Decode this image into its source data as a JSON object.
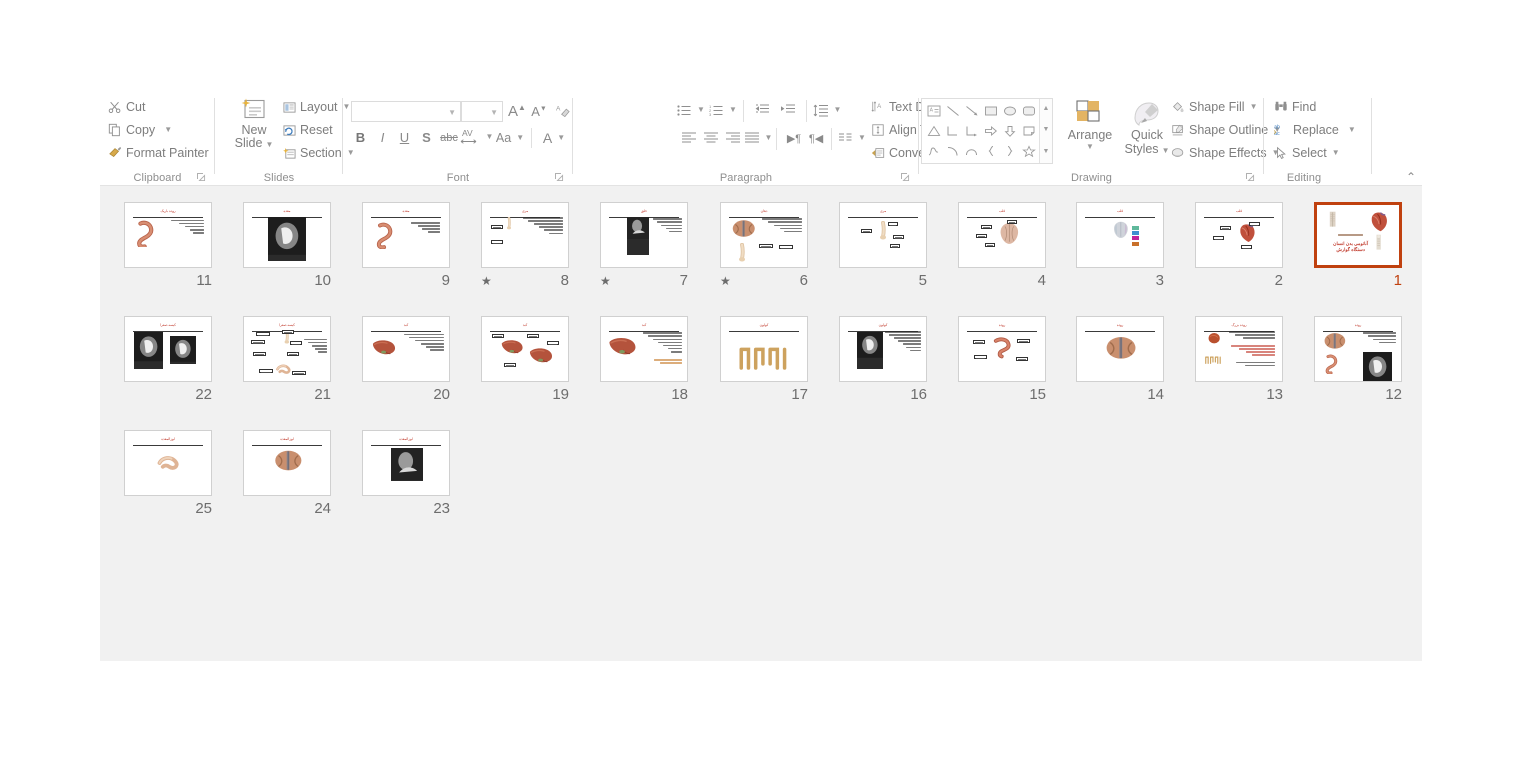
{
  "app": {
    "name": "PowerPoint Slide Sorter",
    "view": "slide-sorter"
  },
  "ribbon": {
    "groups": [
      {
        "id": "clipboard",
        "label": "Clipboard",
        "has_dialog_launcher": true,
        "items": [
          {
            "id": "cut",
            "label": "Cut",
            "icon": "scissors-icon",
            "caret": false
          },
          {
            "id": "copy",
            "label": "Copy",
            "icon": "copy-icon",
            "caret": true
          },
          {
            "id": "format-painter",
            "label": "Format Painter",
            "icon": "paintbrush-icon",
            "caret": false
          }
        ]
      },
      {
        "id": "slides",
        "label": "Slides",
        "has_dialog_launcher": false,
        "items": [
          {
            "id": "new-slide",
            "label": "New Slide",
            "icon": "new-slide-icon",
            "caret": true
          },
          {
            "id": "layout",
            "label": "Layout",
            "icon": "layout-icon",
            "caret": true
          },
          {
            "id": "reset",
            "label": "Reset",
            "icon": "reset-icon",
            "caret": false
          },
          {
            "id": "section",
            "label": "Section",
            "icon": "section-icon",
            "caret": true
          }
        ]
      },
      {
        "id": "font",
        "label": "Font",
        "has_dialog_launcher": true,
        "font_name": {
          "value": "",
          "placeholder": ""
        },
        "font_size": {
          "value": "",
          "placeholder": ""
        },
        "items": [
          {
            "id": "increase-font-size",
            "label": "A",
            "icon": "increase-font-size-icon"
          },
          {
            "id": "decrease-font-size",
            "label": "A",
            "icon": "decrease-font-size-icon"
          },
          {
            "id": "clear-formatting",
            "label": "",
            "icon": "clear-formatting-icon"
          },
          {
            "id": "bold",
            "label": "B",
            "icon": "bold-icon"
          },
          {
            "id": "italic",
            "label": "I",
            "icon": "italic-icon"
          },
          {
            "id": "underline",
            "label": "U",
            "icon": "underline-icon"
          },
          {
            "id": "text-shadow",
            "label": "S",
            "icon": "text-shadow-icon"
          },
          {
            "id": "strikethrough",
            "label": "abc",
            "icon": "strikethrough-icon"
          },
          {
            "id": "character-spacing",
            "label": "AV",
            "icon": "character-spacing-icon"
          },
          {
            "id": "change-case",
            "label": "Aa",
            "icon": "change-case-icon"
          },
          {
            "id": "font-color",
            "label": "A",
            "icon": "font-color-icon"
          }
        ]
      },
      {
        "id": "paragraph",
        "label": "Paragraph",
        "has_dialog_launcher": true,
        "items": [
          {
            "id": "bullets",
            "icon": "bullets-icon",
            "caret": true
          },
          {
            "id": "numbering",
            "icon": "numbering-icon",
            "caret": true
          },
          {
            "id": "decrease-indent",
            "icon": "decrease-indent-icon",
            "caret": false
          },
          {
            "id": "increase-indent",
            "icon": "increase-indent-icon",
            "caret": false
          },
          {
            "id": "line-spacing",
            "icon": "line-spacing-icon",
            "caret": true
          },
          {
            "id": "align-left",
            "icon": "align-left-icon",
            "caret": false
          },
          {
            "id": "align-center",
            "icon": "align-center-icon",
            "caret": false
          },
          {
            "id": "align-right",
            "icon": "align-right-icon",
            "caret": false
          },
          {
            "id": "justify",
            "icon": "justify-icon",
            "caret": true
          },
          {
            "id": "ltr-text-direction",
            "icon": "ltr-paragraph-icon",
            "caret": false
          },
          {
            "id": "rtl-text-direction",
            "icon": "rtl-paragraph-icon",
            "caret": false
          },
          {
            "id": "columns",
            "icon": "columns-icon",
            "caret": true
          }
        ],
        "menu_items": [
          {
            "id": "text-direction",
            "label": "Text Direction",
            "icon": "text-direction-icon",
            "caret": true
          },
          {
            "id": "align-text",
            "label": "Align Text",
            "icon": "align-text-icon",
            "caret": true
          },
          {
            "id": "convert-to-smartart",
            "label": "Convert to SmartArt",
            "icon": "smartart-icon",
            "caret": true
          }
        ]
      },
      {
        "id": "drawing",
        "label": "Drawing",
        "has_dialog_launcher": true,
        "shapes": [
          "text-box-icon",
          "line-icon",
          "arrow-icon",
          "rectangle-icon",
          "oval-icon",
          "rounded-rectangle-icon",
          "triangle-icon",
          "elbow-connector-icon",
          "elbow-arrow-connector-icon",
          "right-arrow-icon",
          "down-arrow-icon",
          "folded-corner-icon",
          "scribble-icon",
          "arc-icon",
          "curve-icon",
          "left-brace-icon",
          "right-brace-icon",
          "star-icon"
        ],
        "items": [
          {
            "id": "arrange",
            "label": "Arrange",
            "icon": "arrange-icon",
            "caret": true
          },
          {
            "id": "quick-styles",
            "label": "Quick Styles",
            "icon": "quick-styles-icon",
            "caret": true
          },
          {
            "id": "shape-fill",
            "label": "Shape Fill",
            "icon": "shape-fill-icon",
            "caret": true
          },
          {
            "id": "shape-outline",
            "label": "Shape Outline",
            "icon": "shape-outline-icon",
            "caret": true
          },
          {
            "id": "shape-effects",
            "label": "Shape Effects",
            "icon": "shape-effects-icon",
            "caret": true
          }
        ]
      },
      {
        "id": "editing",
        "label": "Editing",
        "has_dialog_launcher": false,
        "collapse_icon": "chevron-up-icon",
        "items": [
          {
            "id": "find",
            "label": "Find",
            "icon": "binoculars-icon",
            "caret": false
          },
          {
            "id": "replace",
            "label": "Replace",
            "icon": "replace-icon",
            "caret": true
          },
          {
            "id": "select",
            "label": "Select",
            "icon": "pointer-icon",
            "caret": true
          }
        ]
      }
    ]
  },
  "colors": {
    "selection": "#c0410f",
    "workspace_bg": "#f1f1f1",
    "thumb_border": "#d0d0d0",
    "slide_number": "#6d6d6d",
    "title_red": "#c0392b",
    "ribbon_text": "#7d7d7d"
  },
  "slide_sorter": {
    "direction": "rtl",
    "total_slides": 25,
    "selected_slide": 1,
    "rows": [
      {
        "row": 1,
        "numbers": [
          11,
          10,
          9,
          8,
          7,
          6,
          5,
          4,
          3,
          2,
          1
        ]
      },
      {
        "row": 2,
        "numbers": [
          22,
          21,
          20,
          19,
          18,
          17,
          16,
          15,
          14,
          13,
          12
        ]
      },
      {
        "row": 3,
        "numbers": [
          25,
          24,
          23
        ]
      }
    ],
    "slides": [
      {
        "n": 1,
        "title": "آناتومی بدن انسان",
        "subtitle": "دستگاه گوارش",
        "kind": "title",
        "animated": false,
        "selected": true
      },
      {
        "n": 2,
        "title": "قلب",
        "kind": "labeled-organ",
        "animated": false,
        "selected": false
      },
      {
        "n": 3,
        "title": "قلب",
        "kind": "organ-swatches",
        "animated": false,
        "selected": false
      },
      {
        "n": 4,
        "title": "قلب",
        "kind": "labeled-organ",
        "animated": false,
        "selected": false
      },
      {
        "n": 5,
        "title": "مری",
        "kind": "labeled-organ",
        "animated": false,
        "selected": false
      },
      {
        "n": 6,
        "title": "دهان",
        "kind": "image-text",
        "animated": true,
        "selected": false
      },
      {
        "n": 7,
        "title": "حلق",
        "kind": "photo-text",
        "animated": true,
        "selected": false
      },
      {
        "n": 8,
        "title": "مری",
        "kind": "diagram-text",
        "animated": true,
        "selected": false
      },
      {
        "n": 9,
        "title": "معده",
        "kind": "organ-text",
        "animated": false,
        "selected": false
      },
      {
        "n": 10,
        "title": "معده",
        "kind": "xray",
        "animated": false,
        "selected": false
      },
      {
        "n": 11,
        "title": "روده باریک",
        "kind": "organ-text",
        "animated": false,
        "selected": false
      },
      {
        "n": 12,
        "title": "روده",
        "kind": "multi-image",
        "animated": false,
        "selected": false
      },
      {
        "n": 13,
        "title": "روده بزرگ",
        "kind": "organ-text",
        "animated": false,
        "selected": false
      },
      {
        "n": 14,
        "title": "روده",
        "kind": "organ-only",
        "animated": false,
        "selected": false
      },
      {
        "n": 15,
        "title": "روده",
        "kind": "labeled-organ",
        "animated": false,
        "selected": false
      },
      {
        "n": 16,
        "title": "کولون",
        "kind": "photo-text",
        "animated": false,
        "selected": false
      },
      {
        "n": 17,
        "title": "کولون",
        "kind": "organ-row",
        "animated": false,
        "selected": false
      },
      {
        "n": 18,
        "title": "کبد",
        "kind": "organ-text",
        "animated": false,
        "selected": false
      },
      {
        "n": 19,
        "title": "کبد",
        "kind": "labeled-organ",
        "animated": false,
        "selected": false
      },
      {
        "n": 20,
        "title": "کبد",
        "kind": "organ-text",
        "animated": false,
        "selected": false
      },
      {
        "n": 21,
        "title": "کیسه صفرا",
        "kind": "diagram-text",
        "animated": false,
        "selected": false
      },
      {
        "n": 22,
        "title": "کیسه صفرا",
        "kind": "xray-pair",
        "animated": false,
        "selected": false
      },
      {
        "n": 23,
        "title": "لوزالمعده",
        "kind": "photo-only",
        "animated": false,
        "selected": false
      },
      {
        "n": 24,
        "title": "لوزالمعده",
        "kind": "organ-only",
        "animated": false,
        "selected": false
      },
      {
        "n": 25,
        "title": "لوزالمعده",
        "kind": "organ-only",
        "animated": false,
        "selected": false
      }
    ]
  }
}
